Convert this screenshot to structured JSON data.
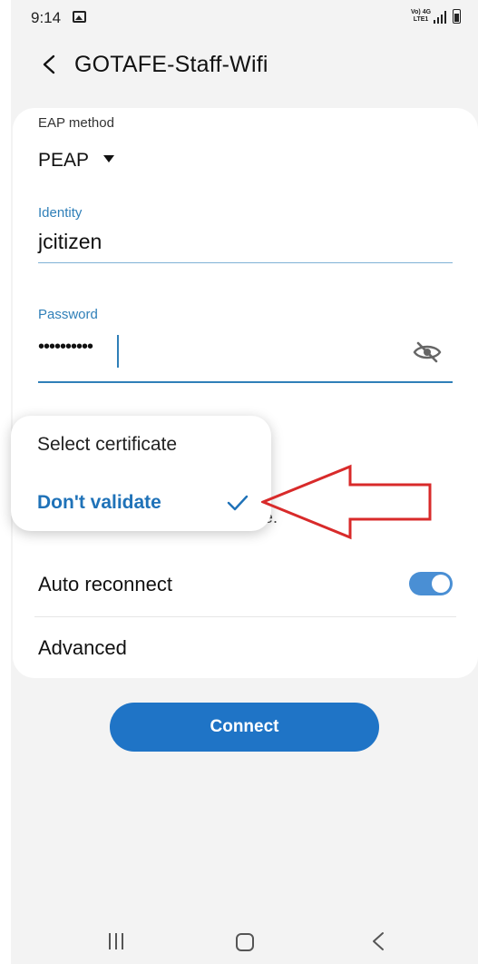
{
  "status_bar": {
    "time": "9:14",
    "network_top": "Vo) 4G",
    "network_bottom": "LTE1"
  },
  "header": {
    "title": "GOTAFE-Staff-Wifi"
  },
  "form": {
    "eap_method_label": "EAP method",
    "eap_method_value": "PEAP",
    "identity_label": "Identity",
    "identity_value": "jcitizen",
    "password_label": "Password",
    "password_value": "••••••••••",
    "warning_text": "Your connection won't be private.",
    "auto_reconnect_label": "Auto reconnect",
    "auto_reconnect_on": true,
    "advanced_label": "Advanced"
  },
  "popup": {
    "title": "Select certificate",
    "selected_option": "Don't validate"
  },
  "connect_label": "Connect",
  "colors": {
    "accent": "#1f74c6",
    "label_blue": "#2f7fb8",
    "annotation_red": "#d82a2a"
  },
  "icons": [
    "back-icon",
    "gallery-icon",
    "signal-icon",
    "battery-icon",
    "eye-off-icon",
    "check-icon",
    "chevron-down-icon"
  ]
}
